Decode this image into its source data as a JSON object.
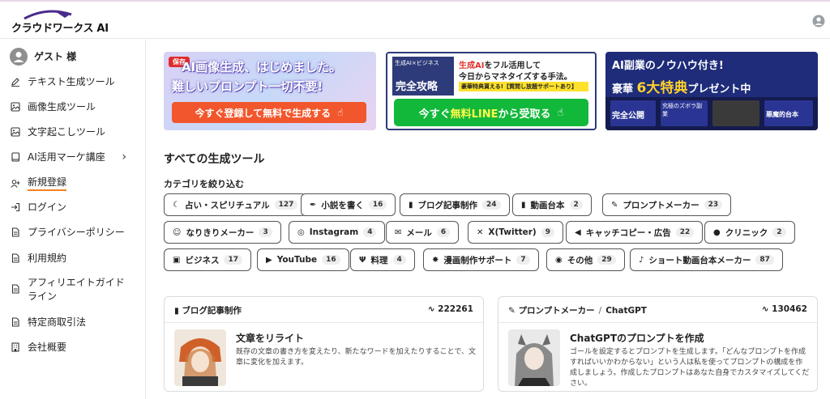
{
  "header": {
    "logo_text": "クラウドワークス AI"
  },
  "sidebar": {
    "user_label": "ゲスト 様",
    "items": [
      {
        "label": "テキスト生成ツール",
        "icon": "pencil-icon"
      },
      {
        "label": "画像生成ツール",
        "icon": "image-icon"
      },
      {
        "label": "文字起こしツール",
        "icon": "image-icon"
      },
      {
        "label": "AI活用マーケ講座",
        "icon": "book-icon"
      },
      {
        "label": "新規登録",
        "icon": "user-plus-icon"
      },
      {
        "label": "ログイン",
        "icon": "login-icon"
      },
      {
        "label": "プライバシーポリシー",
        "icon": "document-icon"
      },
      {
        "label": "利用規約",
        "icon": "document-icon"
      },
      {
        "label": "アフィリエイトガイドライン",
        "icon": "document-icon"
      },
      {
        "label": "特定商取引法",
        "icon": "document-icon"
      },
      {
        "label": "会社概要",
        "icon": "building-icon"
      }
    ],
    "accent": "#f58220"
  },
  "banners": [
    {
      "pin_label": "保存",
      "line1": "AI画像生成、はじめました。",
      "line2": "難しいプロンプト一切不要!",
      "button": "今すぐ登録して無料で生成する"
    },
    {
      "badge_small": "生成AI×ビジネス",
      "badge_title": "完全攻略",
      "line1_red": "生成AI",
      "line1_rest": "をフル活用して",
      "line2": "今日からマネタイズする手法。",
      "strip": "豪華特典貰える!【質問し放題サポートあり】",
      "button_pre": "今すぐ",
      "button_hl": "無料LINE",
      "button_post": "から受取る"
    },
    {
      "line1": "AI副業のノウハウ付き!",
      "line2_pre": "豪華",
      "line2_big": "6大特典",
      "line2_post": "プレゼント中",
      "box1": "完全公開",
      "box2": "究極のズボラ副業",
      "box3": "悪魔的台本"
    }
  ],
  "main": {
    "section_title": "すべての生成ツール",
    "filter_title": "カテゴリを絞り込む"
  },
  "chips": [
    {
      "label": "占い・スピリチュアル",
      "count": "127",
      "icon": "moon-icon"
    },
    {
      "label": "小説を書く",
      "count": "16",
      "icon": "quill-icon"
    },
    {
      "label": "ブログ記事制作",
      "count": "24",
      "icon": "book-icon"
    },
    {
      "label": "動画台本",
      "count": "2",
      "icon": "film-icon"
    },
    {
      "label": "プロンプトメーカー",
      "count": "23",
      "icon": "brush-icon"
    },
    {
      "label": "なりきりメーカー",
      "count": "3",
      "icon": "masks-icon"
    },
    {
      "label": "Instagram",
      "count": "4",
      "icon": "instagram-icon"
    },
    {
      "label": "メール",
      "count": "6",
      "icon": "mail-icon"
    },
    {
      "label": "X(Twitter)",
      "count": "9",
      "icon": "x-icon"
    },
    {
      "label": "キャッチコピー・広告",
      "count": "22",
      "icon": "megaphone-icon"
    },
    {
      "label": "クリニック",
      "count": "2",
      "icon": "doctor-icon"
    },
    {
      "label": "ビジネス",
      "count": "17",
      "icon": "briefcase-icon"
    },
    {
      "label": "YouTube",
      "count": "16",
      "icon": "youtube-icon"
    },
    {
      "label": "料理",
      "count": "4",
      "icon": "utensils-icon"
    },
    {
      "label": "漫画制作サポート",
      "count": "7",
      "icon": "burst-icon"
    },
    {
      "label": "その他",
      "count": "29",
      "icon": "robot-icon"
    },
    {
      "label": "ショート動画台本メーカー",
      "count": "87",
      "icon": "tiktok-icon"
    }
  ],
  "cards": [
    {
      "category": "ブログ記事制作",
      "subcategory": "",
      "count": "222261",
      "title": "文章をリライト",
      "description": "既存の文章の書き方を変えたり、新たなワードを加えたりすることで、文章に変化を加えます。"
    },
    {
      "category": "プロンプトメーカー",
      "subcategory": "ChatGPT",
      "count": "130462",
      "title": "ChatGPTのプロンプトを作成",
      "description": "ゴールを設定するとプロンプトを生成します。「どんなプロンプトを作成すればいいかわからない」という人は私を使ってプロンプトの構成を作成しましょう。作成したプロンプトはあなた自身でカスタマイズしてください。"
    }
  ]
}
